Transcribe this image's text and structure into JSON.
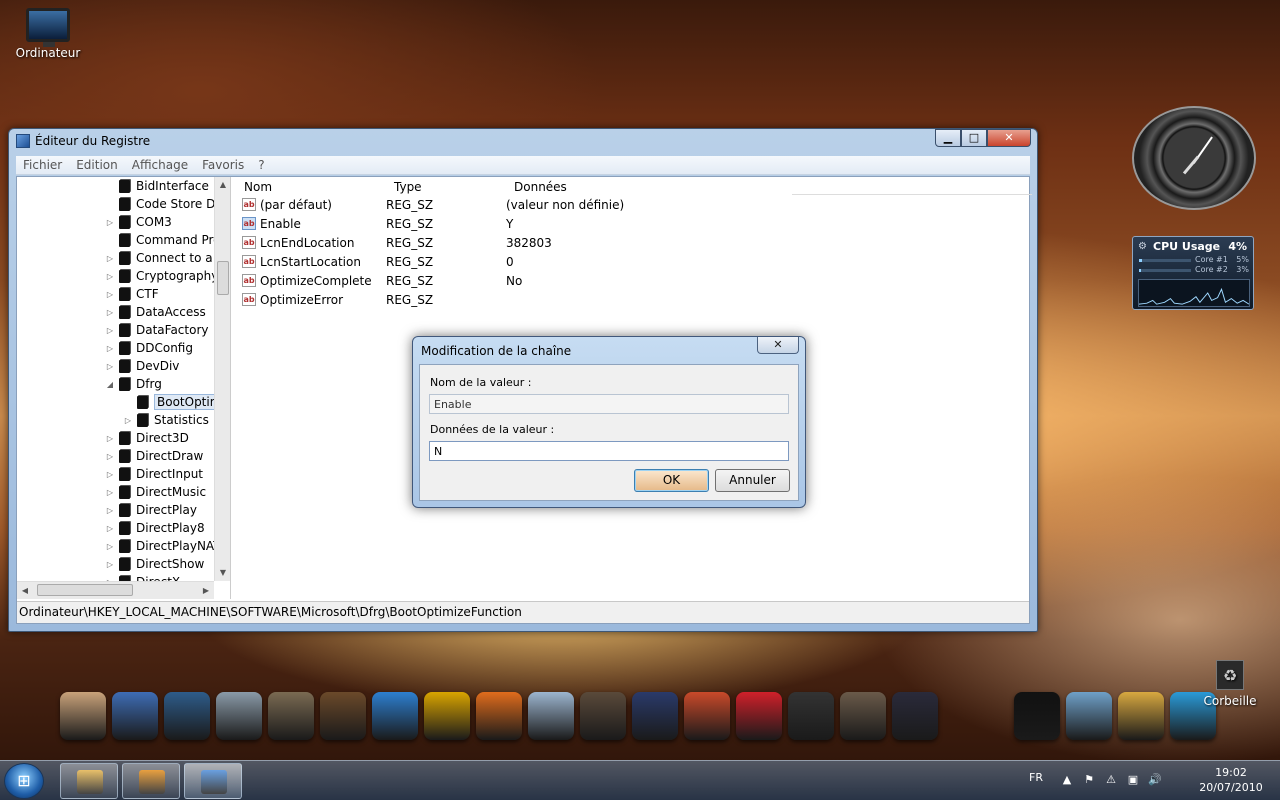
{
  "desktop": {
    "icons": [
      {
        "label": "Ordinateur"
      },
      {
        "label": "Corbeille"
      }
    ]
  },
  "regedit": {
    "title": "Éditeur du Registre",
    "caption": {
      "minimize": "▁",
      "maximize": "□",
      "close": "✕"
    },
    "menu": [
      "Fichier",
      "Edition",
      "Affichage",
      "Favoris",
      "?"
    ],
    "tree": [
      {
        "label": "BidInterface",
        "expander": ""
      },
      {
        "label": "Code Store Dat",
        "expander": ""
      },
      {
        "label": "COM3",
        "expander": "▷"
      },
      {
        "label": "Command Pro",
        "expander": ""
      },
      {
        "label": "Connect to a N",
        "expander": "▷"
      },
      {
        "label": "Cryptography",
        "expander": "▷"
      },
      {
        "label": "CTF",
        "expander": "▷"
      },
      {
        "label": "DataAccess",
        "expander": "▷"
      },
      {
        "label": "DataFactory",
        "expander": "▷"
      },
      {
        "label": "DDConfig",
        "expander": "▷"
      },
      {
        "label": "DevDiv",
        "expander": "▷"
      },
      {
        "label": "Dfrg",
        "expander": "◢"
      },
      {
        "label": "BootOptim",
        "expander": "",
        "child": true,
        "selected": true
      },
      {
        "label": "Statistics",
        "expander": "▷",
        "child": true
      },
      {
        "label": "Direct3D",
        "expander": "▷"
      },
      {
        "label": "DirectDraw",
        "expander": "▷"
      },
      {
        "label": "DirectInput",
        "expander": "▷"
      },
      {
        "label": "DirectMusic",
        "expander": "▷"
      },
      {
        "label": "DirectPlay",
        "expander": "▷"
      },
      {
        "label": "DirectPlay8",
        "expander": "▷"
      },
      {
        "label": "DirectPlayNAT",
        "expander": "▷"
      },
      {
        "label": "DirectShow",
        "expander": "▷"
      },
      {
        "label": "DirectX",
        "expander": "▷"
      }
    ],
    "columns": {
      "name": "Nom",
      "type": "Type",
      "data": "Données"
    },
    "values": [
      {
        "name": "(par défaut)",
        "type": "REG_SZ",
        "data": "(valeur non définie)",
        "icon": "ab"
      },
      {
        "name": "Enable",
        "type": "REG_SZ",
        "data": "Y",
        "icon": "ab",
        "selected": true
      },
      {
        "name": "LcnEndLocation",
        "type": "REG_SZ",
        "data": "382803",
        "icon": "ab"
      },
      {
        "name": "LcnStartLocation",
        "type": "REG_SZ",
        "data": "0",
        "icon": "ab"
      },
      {
        "name": "OptimizeComplete",
        "type": "REG_SZ",
        "data": "No",
        "icon": "ab"
      },
      {
        "name": "OptimizeError",
        "type": "REG_SZ",
        "data": "",
        "icon": "ab"
      }
    ],
    "status_path": "Ordinateur\\HKEY_LOCAL_MACHINE\\SOFTWARE\\Microsoft\\Dfrg\\BootOptimizeFunction"
  },
  "dialog": {
    "title": "Modification de la chaîne",
    "close": "✕",
    "value_name_label": "Nom de la valeur :",
    "value_name": "Enable",
    "value_data_label": "Données de la valeur :",
    "value_data": "N",
    "ok": "OK",
    "cancel": "Annuler"
  },
  "gadgets": {
    "cpu": {
      "title": "CPU Usage",
      "percent": "4%",
      "cores": [
        {
          "label": "Core #1",
          "value": "5%",
          "fraction": 0.05
        },
        {
          "label": "Core #2",
          "value": "3%",
          "fraction": 0.03
        }
      ]
    }
  },
  "dock": {
    "items": [
      "cat-app-icon",
      "file-cabinet-icon",
      "media-player-icon",
      "shield-icon",
      "photo-camera-icon",
      "mule-icon",
      "messenger-icon",
      "k-icon",
      "firefox-mail-icon",
      "shuttle-icon",
      "game-icon",
      "photoshop-icon",
      "chrome-icon",
      "avira-icon",
      "ccleaner-icon",
      "cd-icon",
      "r-icon",
      "monitor-m-icon",
      "notepad-icon",
      "tools-icon",
      "recycle-bin-icon"
    ],
    "colors": [
      "#c9a27a",
      "#3e6db5",
      "#2e5c8a",
      "#8a9aa8",
      "#7a6a52",
      "#6b4a2a",
      "#2d7fd0",
      "#d9a400",
      "#e06c1c",
      "#9cb5cf",
      "#5a4a3a",
      "#2a3a6a",
      "#c94a2a",
      "#d0202a",
      "#333333",
      "#6a5a4a",
      "#2a2a3a",
      "#111111",
      "#6fa0c8",
      "#d8a840",
      "#2a9ad8"
    ]
  },
  "taskbar": {
    "start_glyph": "⊞",
    "buttons": [
      {
        "name": "explorer",
        "color": "#e8c06a"
      },
      {
        "name": "media-player",
        "color": "#e8a040"
      },
      {
        "name": "regedit",
        "color": "#6aa0e0",
        "active": true
      }
    ],
    "language": "FR",
    "tray": [
      "▲",
      "⚑",
      "⚠",
      "▣",
      "🔊"
    ],
    "time": "19:02",
    "date": "20/07/2010"
  }
}
